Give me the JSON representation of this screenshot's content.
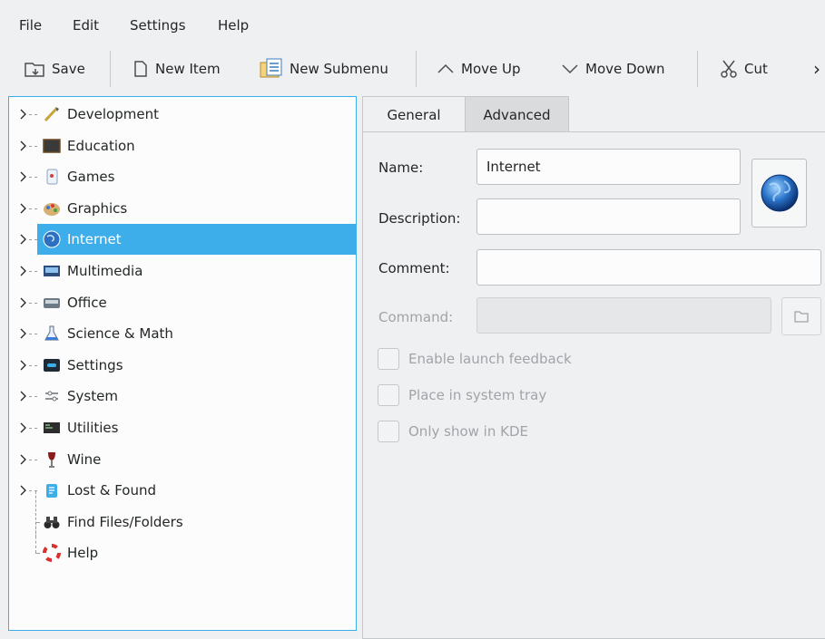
{
  "menubar": {
    "items": [
      "File",
      "Edit",
      "Settings",
      "Help"
    ]
  },
  "toolbar": {
    "save": "Save",
    "new_item": "New Item",
    "new_submenu": "New Submenu",
    "move_up": "Move Up",
    "move_down": "Move Down",
    "cut": "Cut",
    "more": "›"
  },
  "tree": {
    "items": [
      {
        "label": "Development",
        "icon": "development-icon",
        "expandable": true
      },
      {
        "label": "Education",
        "icon": "education-icon",
        "expandable": true
      },
      {
        "label": "Games",
        "icon": "games-icon",
        "expandable": true
      },
      {
        "label": "Graphics",
        "icon": "graphics-icon",
        "expandable": true
      },
      {
        "label": "Internet",
        "icon": "internet-icon",
        "expandable": true,
        "selected": true
      },
      {
        "label": "Multimedia",
        "icon": "multimedia-icon",
        "expandable": true
      },
      {
        "label": "Office",
        "icon": "office-icon",
        "expandable": true
      },
      {
        "label": "Science & Math",
        "icon": "science-icon",
        "expandable": true
      },
      {
        "label": "Settings",
        "icon": "settings-icon",
        "expandable": true
      },
      {
        "label": "System",
        "icon": "system-icon",
        "expandable": true
      },
      {
        "label": "Utilities",
        "icon": "utilities-icon",
        "expandable": true
      },
      {
        "label": "Wine",
        "icon": "wine-icon",
        "expandable": true
      },
      {
        "label": "Lost & Found",
        "icon": "lost-found-icon",
        "expandable": true
      },
      {
        "label": "Find Files/Folders",
        "icon": "binoculars-icon",
        "expandable": false
      },
      {
        "label": "Help",
        "icon": "lifebuoy-icon",
        "expandable": false
      }
    ]
  },
  "tabs": {
    "general": "General",
    "advanced": "Advanced"
  },
  "form": {
    "name_label": "Name:",
    "name_value": "Internet",
    "description_label": "Description:",
    "description_value": "",
    "comment_label": "Comment:",
    "comment_value": "",
    "command_label": "Command:",
    "command_value": "",
    "launch_feedback": "Enable launch feedback",
    "system_tray": "Place in system tray",
    "only_kde": "Only show in KDE"
  },
  "colors": {
    "accent": "#3daee9",
    "window_bg": "#eff0f1",
    "view_bg": "#fcfcfc"
  }
}
